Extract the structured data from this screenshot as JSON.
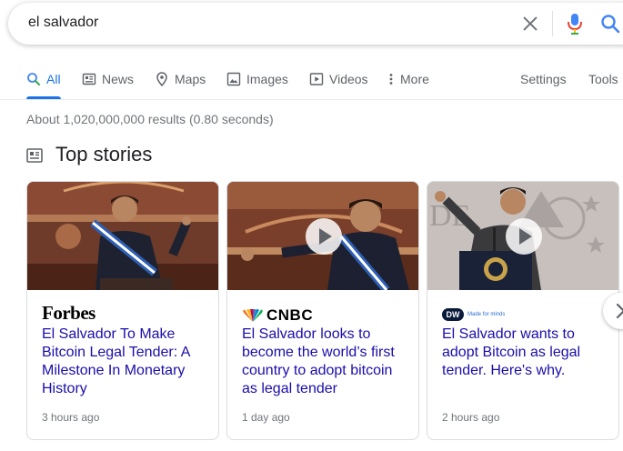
{
  "search": {
    "query": "el salvador"
  },
  "tabs": [
    {
      "label": "All",
      "icon": "search-icon",
      "active": true
    },
    {
      "label": "News",
      "icon": "news-icon"
    },
    {
      "label": "Maps",
      "icon": "map-pin-icon"
    },
    {
      "label": "Images",
      "icon": "image-icon"
    },
    {
      "label": "Videos",
      "icon": "play-icon"
    },
    {
      "label": "More",
      "icon": "more-vertical-icon"
    }
  ],
  "tools": {
    "settings": "Settings",
    "tools": "Tools"
  },
  "result_stats": "About 1,020,000,000 results (0.80 seconds)",
  "top_stories": {
    "title": "Top stories",
    "cards": [
      {
        "publisher": "Forbes",
        "headline": "El Salvador To Make Bitcoin Legal Tender: A Milestone In Monetary History",
        "time": "3 hours ago",
        "video": false
      },
      {
        "publisher": "CNBC",
        "headline": "El Salvador looks to become the world’s first country to adopt bitcoin as legal tender",
        "time": "1 day ago",
        "video": true
      },
      {
        "publisher": "DW",
        "publisher_tagline": "Made for minds",
        "headline": "El Salvador wants to adopt Bitcoin as legal tender. Here's why.",
        "time": "2 hours ago",
        "video": true
      }
    ]
  },
  "colors": {
    "link": "#1a0dab",
    "accent": "#1a73e8",
    "muted": "#70757a"
  }
}
